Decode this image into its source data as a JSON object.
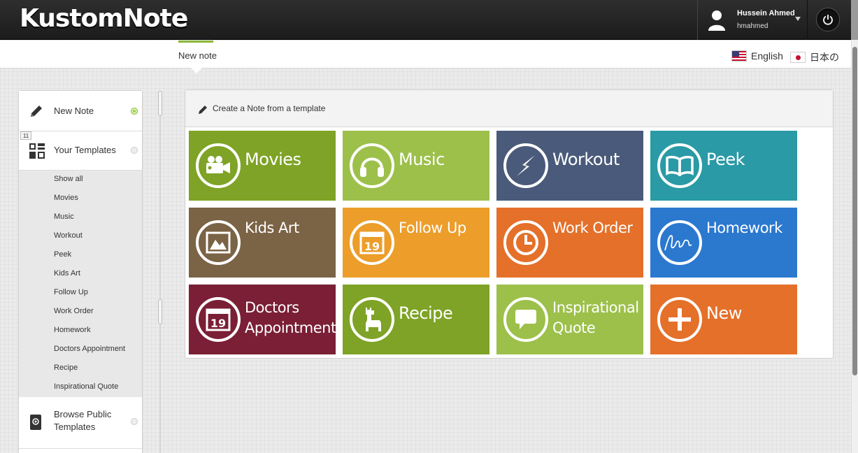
{
  "header": {
    "logo": "KustomNote",
    "user_name": "Hussein Ahmed",
    "user_handle": "hmahmed"
  },
  "subnav": {
    "tab": "New note",
    "lang_en": "English",
    "lang_ja": "日本の"
  },
  "sidebar": {
    "new_note": "New Note",
    "templates_count": "11",
    "your_templates": "Your Templates",
    "template_items": [
      "Show all",
      "Movies",
      "Music",
      "Workout",
      "Peek",
      "Kids Art",
      "Follow Up",
      "Work Order",
      "Homework",
      "Doctors Appointment",
      "Recipe",
      "Inspirational Quote"
    ],
    "browse_line1": "Browse Public",
    "browse_line2": "Templates"
  },
  "panel": {
    "title": "Create a Note from a template"
  },
  "tiles": [
    {
      "line1": "Movies",
      "line2": "",
      "icon": "film-camera-icon",
      "color": "#7ea326"
    },
    {
      "line1": "Music",
      "line2": "",
      "icon": "headphones-icon",
      "color": "#9cc04a"
    },
    {
      "line1": "Workout",
      "line2": "",
      "icon": "lightning-icon",
      "color": "#4a5a7a"
    },
    {
      "line1": "Peek",
      "line2": "",
      "icon": "book-icon",
      "color": "#2a9aa6"
    },
    {
      "line1": "Kids Art",
      "line2": "",
      "icon": "picture-icon",
      "color": "#7b6346"
    },
    {
      "line1": "Follow Up",
      "line2": "",
      "icon": "calendar-icon",
      "color": "#ec9d2a"
    },
    {
      "line1": "Work Order",
      "line2": "",
      "icon": "clock-icon",
      "color": "#e4702a"
    },
    {
      "line1": "Homework",
      "line2": "",
      "icon": "signature-icon",
      "color": "#2b78cf"
    },
    {
      "line1": "Doctors",
      "line2": "Appointment",
      "icon": "calendar-icon",
      "color": "#7a1f35"
    },
    {
      "line1": "Recipe",
      "line2": "",
      "icon": "llama-icon",
      "color": "#7ea326"
    },
    {
      "line1": "Inspirational",
      "line2": "Quote",
      "icon": "speech-bubble-icon",
      "color": "#9cc04a"
    },
    {
      "line1": "New",
      "line2": "",
      "icon": "plus-icon",
      "color": "#e4702a"
    }
  ],
  "calendar_day": "19"
}
